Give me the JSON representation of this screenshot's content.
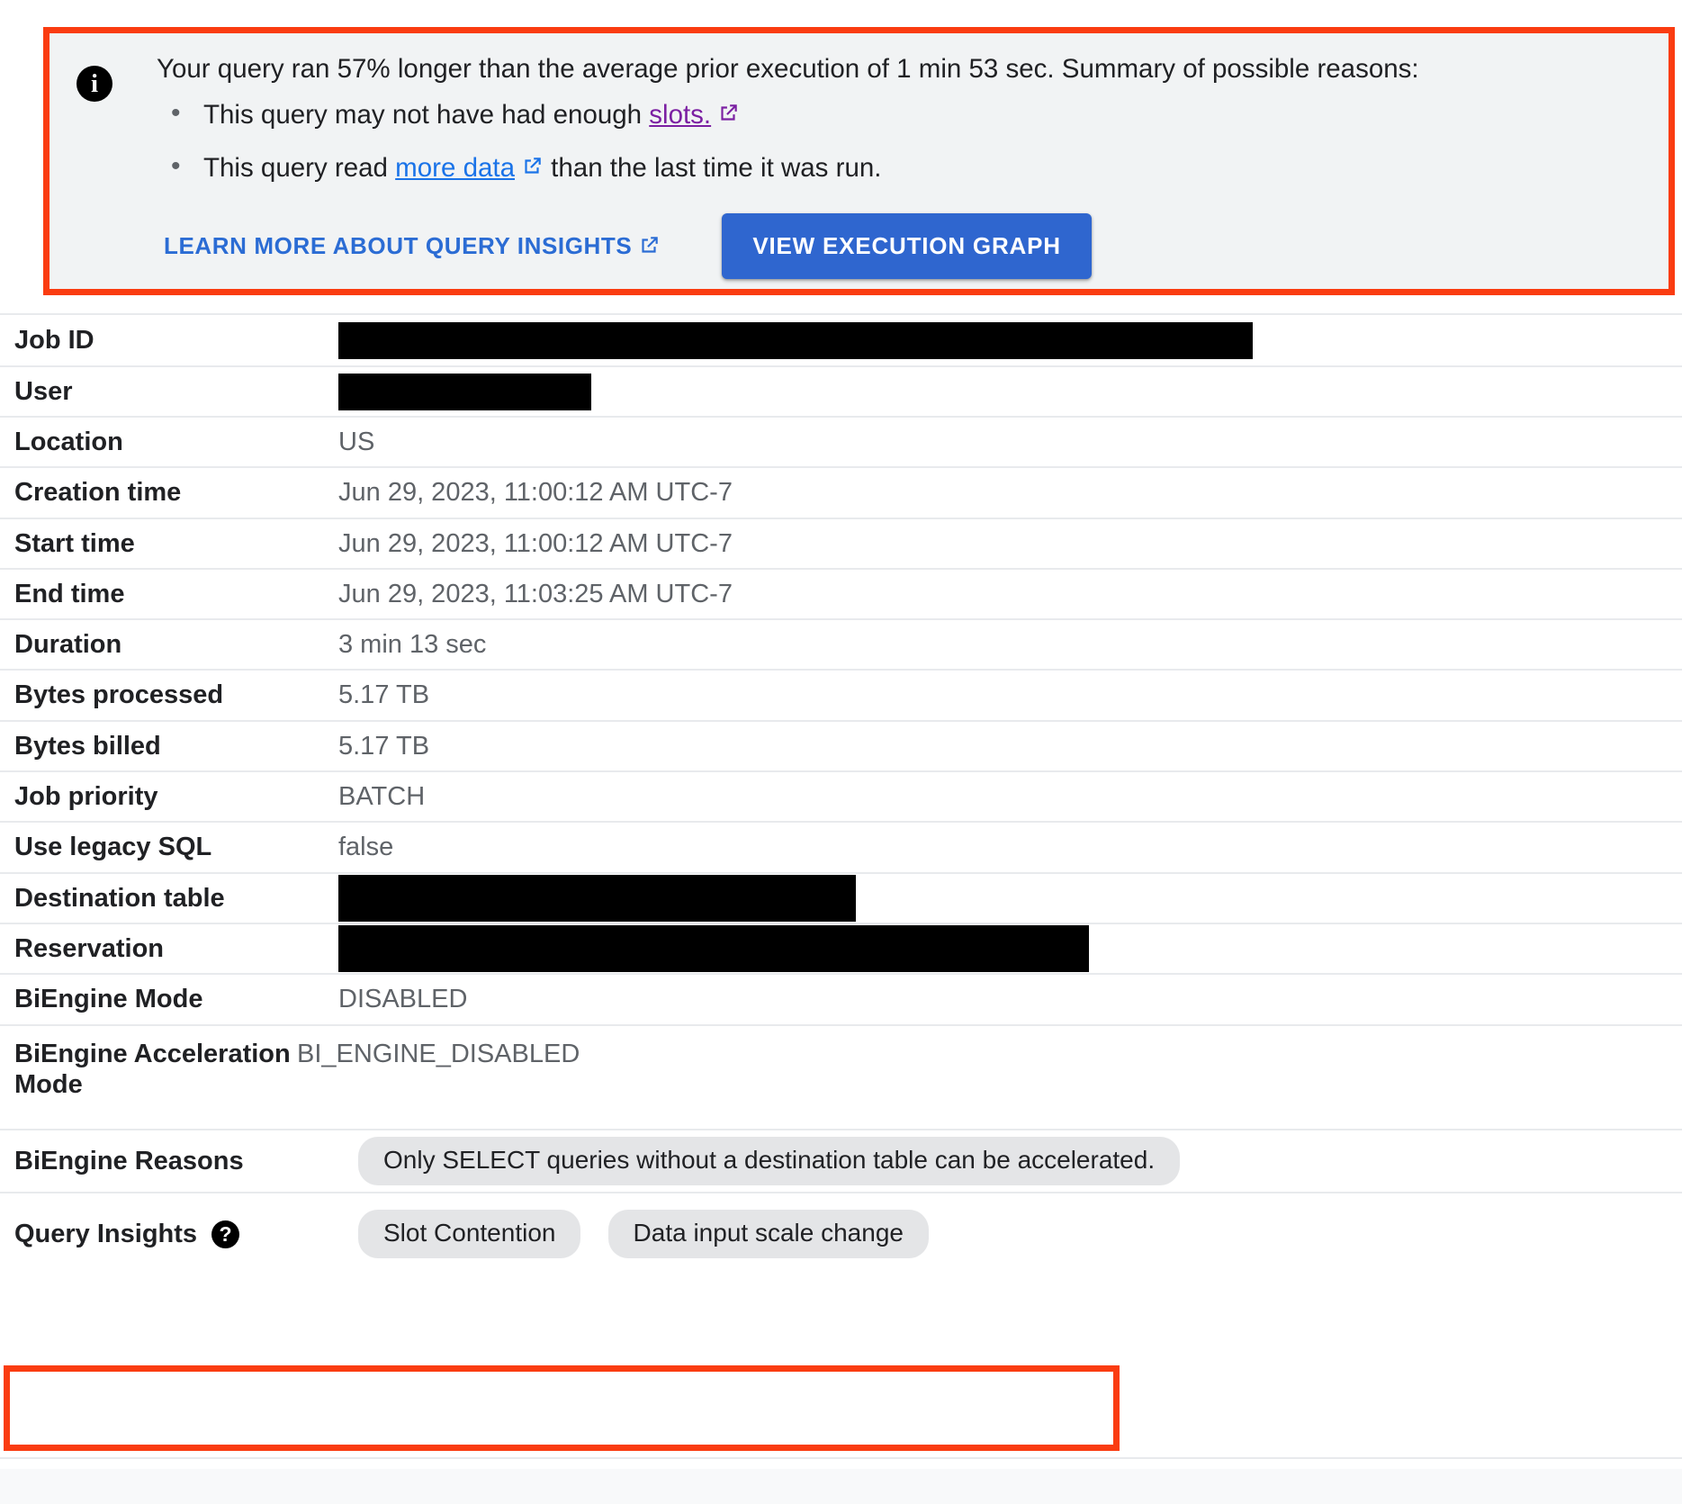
{
  "banner": {
    "icon": "info-icon",
    "lead_text": "Your query ran 57% longer than the average prior execution of 1 min 53 sec. Summary of possible reasons:",
    "bullets": [
      {
        "prefix": "This query may not have had enough ",
        "link": "slots.",
        "suffix": "",
        "link_state": "visited",
        "has_external_icon": true
      },
      {
        "prefix": "This query read ",
        "link": "more data",
        "suffix": " than the last time it was run.",
        "link_state": "default",
        "has_external_icon": true
      }
    ],
    "learn_more_label": "LEARN MORE ABOUT QUERY INSIGHTS",
    "view_graph_label": "VIEW EXECUTION GRAPH",
    "accent_color": "#2f66cf",
    "visited_link_color": "#7b1fa2",
    "link_color": "#1a73e8",
    "highlight_color": "#fa3c11",
    "background_color": "#f1f3f4"
  },
  "details": {
    "rows": [
      {
        "label": "Job ID",
        "type": "redacted",
        "redact_width": 1016
      },
      {
        "label": "User",
        "type": "redacted",
        "redact_width": 281
      },
      {
        "label": "Location",
        "type": "text",
        "value": "US"
      },
      {
        "label": "Creation time",
        "type": "text",
        "value": "Jun 29, 2023, 11:00:12 AM UTC-7"
      },
      {
        "label": "Start time",
        "type": "text",
        "value": "Jun 29, 2023, 11:00:12 AM UTC-7"
      },
      {
        "label": "End time",
        "type": "text",
        "value": "Jun 29, 2023, 11:03:25 AM UTC-7"
      },
      {
        "label": "Duration",
        "type": "text",
        "value": "3 min 13 sec"
      },
      {
        "label": "Bytes processed",
        "type": "text",
        "value": "5.17 TB"
      },
      {
        "label": "Bytes billed",
        "type": "text",
        "value": "5.17 TB"
      },
      {
        "label": "Job priority",
        "type": "text",
        "value": "BATCH"
      },
      {
        "label": "Use legacy SQL",
        "type": "text",
        "value": "false"
      },
      {
        "label": "Destination table",
        "type": "redacted",
        "redact_width": 575
      },
      {
        "label": "Reservation",
        "type": "redacted",
        "redact_width": 834
      },
      {
        "label": "BiEngine Mode",
        "type": "text",
        "value": "DISABLED"
      },
      {
        "label": "BiEngine Acceleration Mode",
        "type": "text",
        "value": "BI_ENGINE_DISABLED"
      },
      {
        "label": "BiEngine Reasons",
        "type": "chips",
        "chips": [
          "Only SELECT queries without a destination table can be accelerated."
        ]
      },
      {
        "label": "Query Insights",
        "type": "chips",
        "has_help_icon": true,
        "chips": [
          "Slot Contention",
          "Data input scale change"
        ]
      }
    ]
  },
  "labels": {
    "job_id": "Job ID",
    "user": "User",
    "location": "Location",
    "creation_time": "Creation time",
    "start_time": "Start time",
    "end_time": "End time",
    "duration": "Duration",
    "bytes_processed": "Bytes processed",
    "bytes_billed": "Bytes billed",
    "job_priority": "Job priority",
    "use_legacy_sql": "Use legacy SQL",
    "destination_table": "Destination table",
    "reservation": "Reservation",
    "biengine_mode": "BiEngine Mode",
    "biengine_acceleration_mode": "BiEngine Acceleration Mode",
    "biengine_reasons": "BiEngine Reasons",
    "query_insights": "Query Insights"
  },
  "values": {
    "location": "US",
    "creation_time": "Jun 29, 2023, 11:00:12 AM UTC-7",
    "start_time": "Jun 29, 2023, 11:00:12 AM UTC-7",
    "end_time": "Jun 29, 2023, 11:03:25 AM UTC-7",
    "duration": "3 min 13 sec",
    "bytes_processed": "5.17 TB",
    "bytes_billed": "5.17 TB",
    "job_priority": "BATCH",
    "use_legacy_sql": "false",
    "biengine_mode": "DISABLED",
    "biengine_acceleration_mode": "BI_ENGINE_DISABLED",
    "biengine_reason_chip": "Only SELECT queries without a destination table can be accelerated.",
    "query_insight_chip_1": "Slot Contention",
    "query_insight_chip_2": "Data input scale change"
  }
}
